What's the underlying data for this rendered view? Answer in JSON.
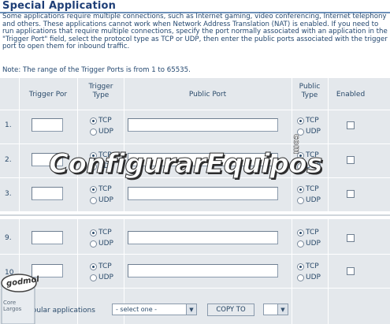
{
  "page": {
    "title": "Special Application",
    "description": "Some applications require multiple connections, such as Internet gaming, video conferencing, Internet telephony and others. These applications cannot work when Network Address Translation (NAT) is enabled. If you need to run applications that require multiple connections, specify the port normally associated with an application in the \"Trigger Port\" field, select the protocol type as TCP or UDP, then enter the public ports associated with the trigger port to open them for inbound traffic.",
    "note": "Note: The range of the Trigger Ports is from 1 to 65535."
  },
  "table": {
    "headers": {
      "trigger_port": "Trigger Por",
      "trigger_type": "Trigger Type",
      "public_port": "Public Port",
      "public_type": "Public Type",
      "enabled": "Enabled"
    },
    "rows": [
      {
        "num": "1.",
        "trigger_port": "",
        "trigger_type": "TCP",
        "public_port": "",
        "public_type": "TCP",
        "enabled": false
      },
      {
        "num": "2.",
        "trigger_port": "",
        "trigger_type": "TCP",
        "public_port": "",
        "public_type": "TCP",
        "enabled": false
      },
      {
        "num": "3.",
        "trigger_port": "",
        "trigger_type": "TCP",
        "public_port": "",
        "public_type": "TCP",
        "enabled": false
      },
      {
        "num": "9.",
        "trigger_port": "",
        "trigger_type": "TCP",
        "public_port": "",
        "public_type": "TCP",
        "enabled": false
      },
      {
        "num": "10",
        "trigger_port": "",
        "trigger_type": "TCP",
        "public_port": "",
        "public_type": "TCP",
        "enabled": false
      }
    ],
    "tcp_label": "TCP",
    "udp_label": "UDP"
  },
  "footer": {
    "popular_label": "Popular applications",
    "select_value": "- select one -",
    "copy_button": "COPY TO",
    "target_value": ""
  },
  "watermark": {
    "text": "ConfigurarEquipos",
    "suffix": "com"
  },
  "logo": {
    "text": "godmol",
    "sub": "Core Largos"
  },
  "colors": {
    "title": "#1f3f77",
    "text": "#23476f",
    "grid_bg": "#e4e8ec"
  }
}
